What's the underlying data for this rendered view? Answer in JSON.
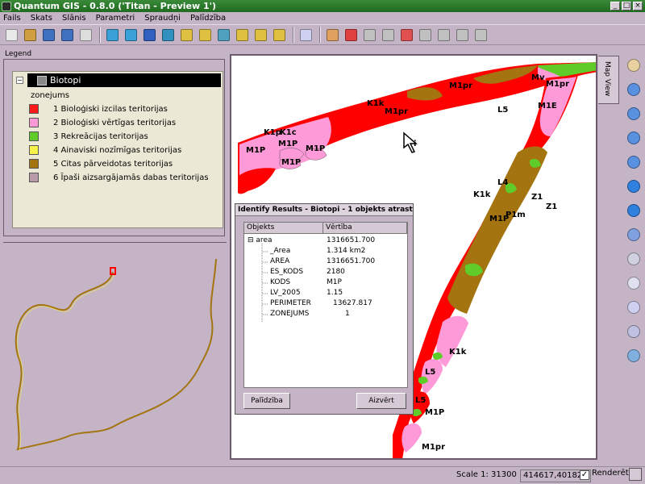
{
  "window": {
    "title": "Quantum GIS - 0.8.0 ('Titan - Preview 1')"
  },
  "menu": [
    "Fails",
    "Skats",
    "Slānis",
    "Parametri",
    "Spraudņi",
    "Palīdzība"
  ],
  "toolbar": {
    "icons": [
      "new-project-icon",
      "open-project-icon",
      "save-project-icon",
      "save-as-icon",
      "print-icon",
      "add-vector-layer-icon",
      "add-raster-layer-icon",
      "add-postgis-layer-icon",
      "add-wms-layer-icon",
      "zoom-full-icon",
      "zoom-layer-icon",
      "refresh-icon",
      "zoom-in-icon",
      "zoom-out-icon",
      "pan-icon",
      "measure-icon",
      "toggle-editing-icon",
      "capture-point-icon",
      "capture-line-icon",
      "capture-polygon-icon",
      "delete-feature-icon",
      "cut-icon",
      "copy-icon",
      "paste-icon",
      "add-ring-icon"
    ]
  },
  "legend": {
    "label": "Legend",
    "layer_name": "Biotopi",
    "classification_field": "zonejums",
    "classes": [
      {
        "label": "1 Bioloģiski izcilas teritorijas",
        "color": "#ff1a1a"
      },
      {
        "label": "2 Bioloģiski vērtīgas teritorijas",
        "color": "#ff9ad8"
      },
      {
        "label": "3 Rekreācijas teritorijas",
        "color": "#5fcc2a"
      },
      {
        "label": "4 Ainaviski nozīmīgas teritorijas",
        "color": "#f7f24a"
      },
      {
        "label": "5 Citas pārveidotas teritorijas",
        "color": "#a3740f"
      },
      {
        "label": "6 Īpaši aizsargājamās dabas teritorijas",
        "color": "#b89aa8"
      }
    ]
  },
  "map": {
    "tab_label": "Map View",
    "colors": {
      "red": "#ff0000",
      "pink": "#ff9ad8",
      "green": "#5fcc2a",
      "brown": "#a3740f",
      "grey": "#b89aa8"
    },
    "labels": [
      "M1P",
      "M1pr",
      "K1k",
      "K1p",
      "K1c",
      "L5",
      "L4",
      "Z1",
      "P1m",
      "M1E",
      "Mv",
      "M1P",
      "M1P",
      "M1P",
      "M1pr",
      "M1pr",
      "M1P",
      "L5",
      "L5",
      "K1k",
      "M1P",
      "M1pr",
      "K1k",
      "Z1"
    ]
  },
  "identify": {
    "title": "Identify Results - Biotopi - 1 objekts atrasts",
    "col_objects": "Objekts",
    "col_value": "Vērtība",
    "root": {
      "name": "area",
      "value": "1316651.700"
    },
    "rows": [
      {
        "name": "_Area",
        "value": "1.314 km2"
      },
      {
        "name": "AREA",
        "value": "1316651.700"
      },
      {
        "name": "ES_KODS",
        "value": "2180"
      },
      {
        "name": "KODS",
        "value": "M1P"
      },
      {
        "name": "LV_2005",
        "value": "1.15"
      },
      {
        "name": "PERIMETER",
        "value": "13627.817"
      },
      {
        "name": "ZONEJUMS",
        "value": "1"
      }
    ],
    "help_button": "Palīdzība",
    "close_button": "Aizvērt"
  },
  "status": {
    "scale": "Scale 1: 31300",
    "coords": "414617,401823",
    "render_label": "Renderēt",
    "render_checked": "✓"
  }
}
